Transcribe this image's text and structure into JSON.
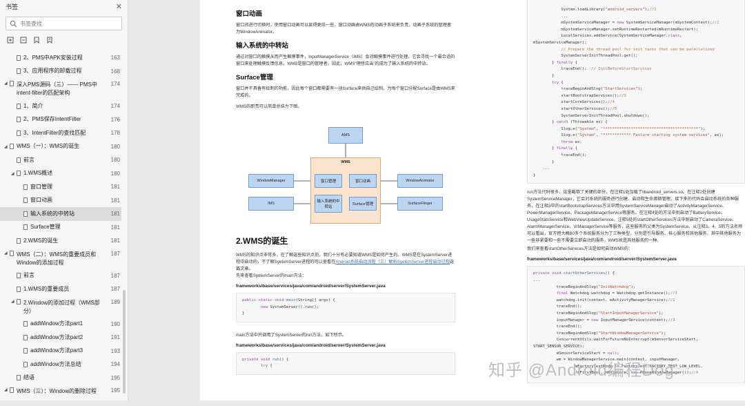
{
  "sidebar": {
    "title": "书签",
    "search_placeholder": "书签查找",
    "items": [
      {
        "label": "2、PMS中APK安装过程",
        "page": "163"
      },
      {
        "label": "3、应用程序的卸载过程",
        "page": "168"
      },
      {
        "label": "深入PMS源码（三）—— PMS中intent-filter的匹配架构",
        "page": "174"
      },
      {
        "label": "1、简介",
        "page": "174"
      },
      {
        "label": "2、PMS保存IntentFilter",
        "page": "176"
      },
      {
        "label": "3、IntentFilter的查找匹配",
        "page": "178"
      },
      {
        "label": "WMS（一）：WMS的诞生",
        "page": "180"
      },
      {
        "label": "前言",
        "page": "180"
      },
      {
        "label": "1.WMS概述",
        "page": "180"
      },
      {
        "label": "窗口管理",
        "page": "181"
      },
      {
        "label": "窗口动画",
        "page": "181"
      },
      {
        "label": "输入系统的中转站",
        "page": "181"
      },
      {
        "label": "Surface管理",
        "page": "181"
      },
      {
        "label": "2.WMS的诞生",
        "page": "181"
      },
      {
        "label": "WMS（二）：WMS的重要成员和Window的添加过程",
        "page": "187"
      },
      {
        "label": "前言",
        "page": "187"
      },
      {
        "label": "1.WMS的重要成员",
        "page": "187"
      },
      {
        "label": "2.Window的添加过程（WMS部分）",
        "page": "189"
      },
      {
        "label": "addWindow方法part1",
        "page": "190"
      },
      {
        "label": "addWindow方法part2",
        "page": "191"
      },
      {
        "label": "addWindow方法part3",
        "page": "193"
      },
      {
        "label": "addWindow方法总结",
        "page": "194"
      },
      {
        "label": "结语",
        "page": "195"
      },
      {
        "label": "WMS（三）：Window的删除过程",
        "page": "195"
      }
    ]
  },
  "left": {
    "h_anim": "窗口动画",
    "p_anim": "窗口间进行切换时，使用窗口动画可以显得更炫一些，窗口动画由WMS的动画子系统来负责，动画子系统的管理者为WindowAnimator。",
    "h_input": "输入系统的中转站",
    "p_input": "通过对窗口的触摸从而产生触摸事件，InputManagerService（IMS）会对触摸事件进行处理，它会寻找一个最合适的窗口来处理触摸反馈信息，WMS是窗口的管理者，因此，WMS“理所应当”的成为了输入系统的中转站。",
    "h_surface": "Surface管理",
    "p_surface": "窗口并不具备有绘制的功能，因此每个窗口都需要有一块Surface来供自己绘制。为每个窗口分配Surface是由WMS来完成的。",
    "p_role": "WMS的职责可以简单总结为下图。",
    "diagram": {
      "wms_top": "AMS",
      "wms_box": "WMS",
      "window_manager": "WindowManager",
      "window_manage": "窗口管理",
      "window_anim": "窗口动画",
      "window_animator": "WindowAnimator",
      "ims": "IMS",
      "input_relay": "输入系统的中转站",
      "surface_manage": "Surface管理",
      "surface_flinger": "SurfaceFlinger"
    },
    "h_birth": "2.WMS的诞生",
    "p_birth_1": "WMS的知识点非常多，在了解这些知识点前，我们十分有必要知道WMS是如何产生的。WMS是在SystemServer进程中启动的，不了解SyetemServer进程的可以查看在",
    "p_birth_link": "Android系统启动流程（三）解析SyetemServer进程启动过程",
    "p_birth_2": "这篇文章。",
    "p_birth_3": "先来查看SyetemServer的main方法：",
    "path_1": "frameworks/base/services/java/com/android/server/SystemServer.java",
    "p_run": "main方法中只调用了SystemServer的run方法，如下所示。",
    "path_2": "frameworks/base/services/java/com/android/server/SystemServer.java"
  },
  "right": {
    "p_run_desc": "run方法代码很多，这里截取了关键的部分，在注释1处加载了libandroid_servers.so。在注释2处创建SystemServiceManager，它会对系统的服务进行创建、启动和生命周期管理。接下来的代码会启动系统的各种服务，在注释3中的startBootstrapServices方法中用SystemServiceManager启动了ActivityManagerService、PowerManagerService、PackageManagerService等服务。在注释4处的方法中则启动了BatteryService、UsageStatsService和WebViewUpdateService。注释5处的startOtherServices方法中则启动了CameraService、AlarmManagerService、VrManagerService等服务，这些服务的父类为SystemService。从注释3、4、5的方法名称可以看出，官方把大概80多个系统服务分为了三种类型，分别是引导服务、核心服务和其他服务，其中其他服务为一些非紧要和一些不需要立即启动的服务，WMS就是其他服务的一种。",
    "p_look": "我们来查看startOtherServices方法是如何启动WMS的：",
    "path_3": "frameworks/base/services/java/com/android/server/SystemServer.java"
  },
  "watermark": "知乎 @Android编程Dog"
}
